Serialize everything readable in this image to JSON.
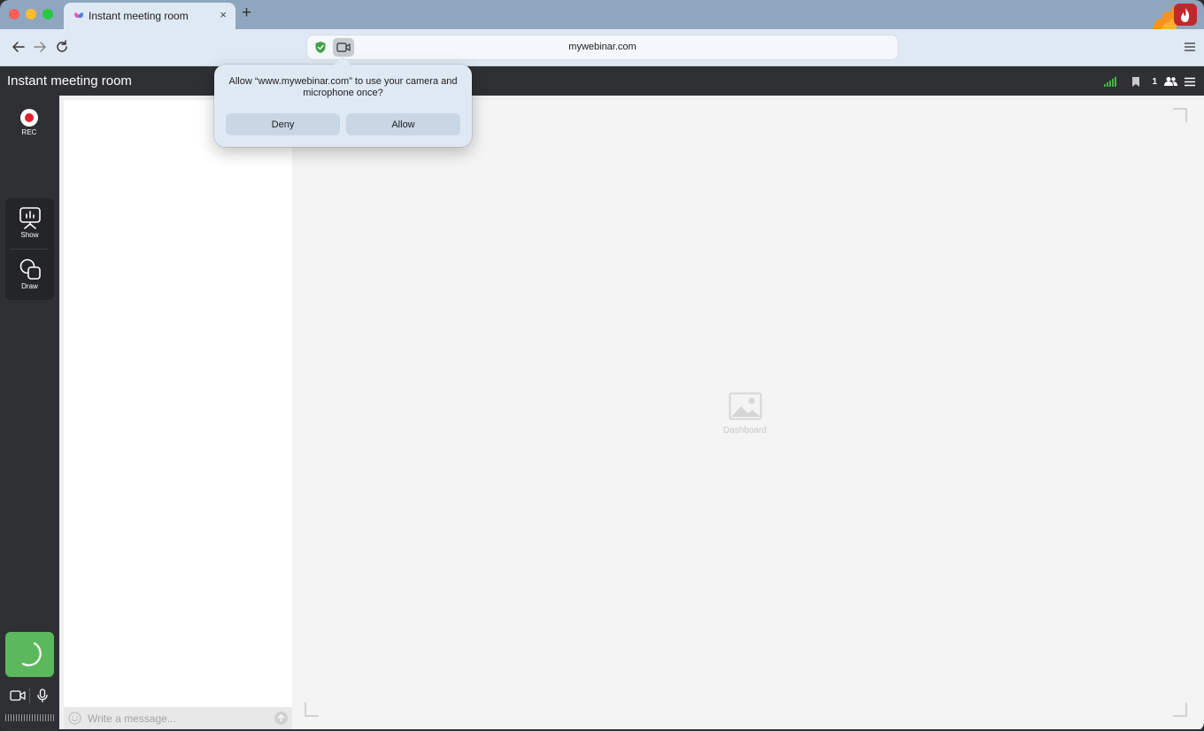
{
  "browser": {
    "tab": {
      "title": "Instant meeting room",
      "close_glyph": "×"
    },
    "new_tab_glyph": "+",
    "url": "mywebinar.com"
  },
  "permission_prompt": {
    "message": "Allow “www.mywebinar.com” to use your camera and microphone once?",
    "deny_label": "Deny",
    "allow_label": "Allow"
  },
  "app": {
    "room_title": "Instant meeting room",
    "participants_count": "1",
    "rec_label": "REC",
    "tools": [
      {
        "label": "Show"
      },
      {
        "label": "Draw"
      }
    ],
    "chat": {
      "placeholder": "Write a message..."
    },
    "stage": {
      "placeholder_label": "Dashboard"
    }
  },
  "colors": {
    "accent_green": "#5cb85c",
    "record_red": "#e0222a",
    "signal_green": "#4caf50",
    "tab_strip": "#8fa6bf"
  }
}
